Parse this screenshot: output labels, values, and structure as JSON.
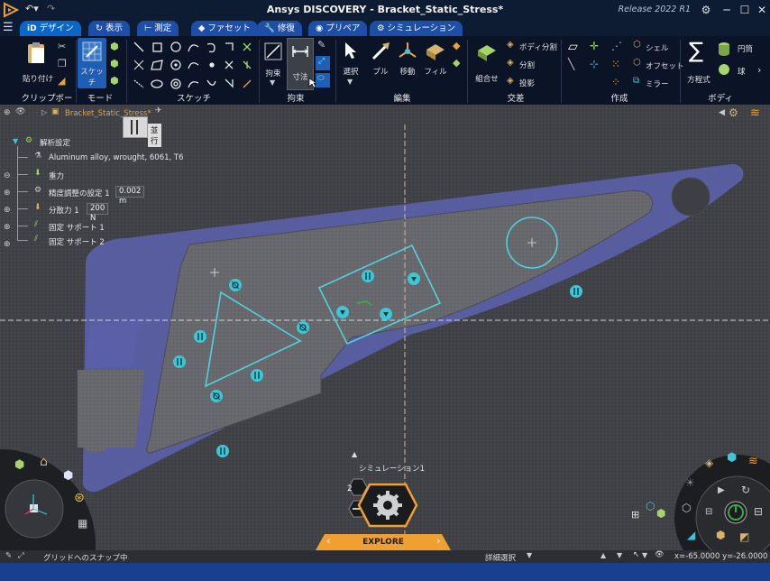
{
  "window": {
    "title": "Ansys DISCOVERY - Bracket_Static_Stress*",
    "release": "Release 2022 R1"
  },
  "tabs": [
    {
      "label": "デザイン"
    },
    {
      "label": "表示"
    },
    {
      "label": "測定"
    },
    {
      "label": "ファセット"
    },
    {
      "label": "修復"
    },
    {
      "label": "プリペア"
    },
    {
      "label": "シミュレーション"
    }
  ],
  "ribbon": {
    "clipboard": {
      "paste": "貼り付け",
      "group": "クリップボード"
    },
    "mode": {
      "sketch": "スケッチ",
      "group": "モード"
    },
    "sketch": {
      "group": "スケッチ"
    },
    "constraint": {
      "constrain": "拘束",
      "dimension": "寸法",
      "group": "拘束"
    },
    "edit": {
      "select": "選択",
      "pull": "プル",
      "move": "移動",
      "fill": "フィル",
      "group": "編集"
    },
    "intersect": {
      "combine": "組合せ",
      "split_body": "ボディ分割",
      "split": "分割",
      "project": "投影",
      "group": "交差"
    },
    "create": {
      "shell": "シェル",
      "offset": "オフセット",
      "mirror": "ミラー",
      "group": "作成"
    },
    "body": {
      "equation": "方程式",
      "cylinder": "円筒",
      "sphere": "球",
      "group": "ボディ"
    }
  },
  "tree": {
    "doc": "Bracket_Static_Stress*",
    "parallel_tooltip": "並行",
    "items": [
      {
        "label": "解析設定"
      },
      {
        "label": "Aluminum alloy, wrought, 6061, T6"
      },
      {
        "label": "重力"
      },
      {
        "label": "精度調整の設定 1",
        "value": "0.002 m"
      },
      {
        "label": "分散力 1",
        "value": "200 N"
      },
      {
        "label": "固定 サポート 1"
      },
      {
        "label": "固定 サポート 2"
      }
    ]
  },
  "simulation": {
    "label": "シミュレーション1",
    "count": "2",
    "explore": "EXPLORE"
  },
  "status": {
    "message": "グリッドへのスナップ中",
    "selection": "詳細選択",
    "coords": "x=-65.0000  y=-26.0000"
  },
  "colors": {
    "accent": "#0b66c9",
    "tab": "#1d4fa8",
    "part": "#5a5fa8",
    "constraint": "#3ec6d6",
    "explore": "#f0a030"
  }
}
